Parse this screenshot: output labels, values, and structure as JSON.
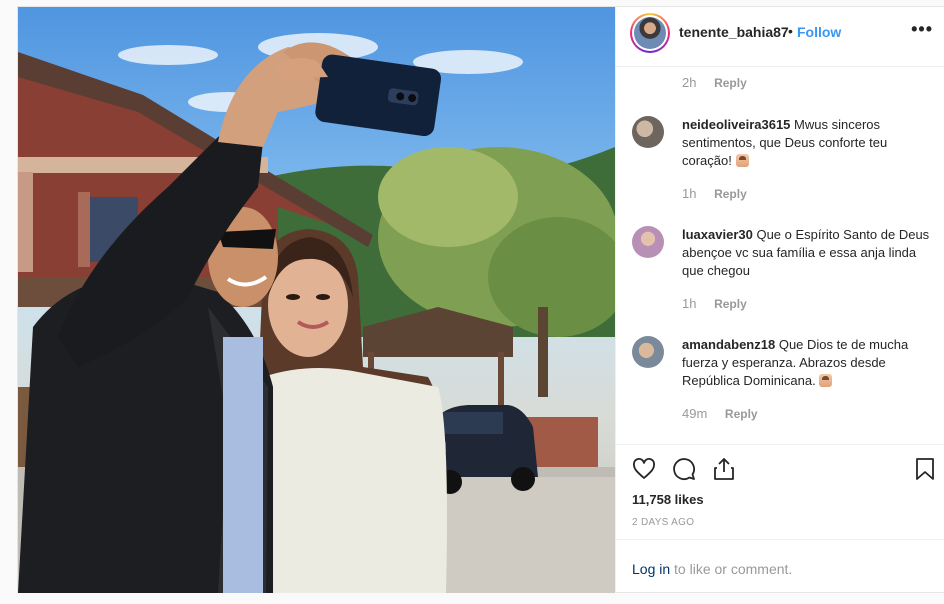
{
  "header": {
    "username": "tenente_bahia87",
    "separator": "•",
    "follow_label": "Follow",
    "more_label": "•••"
  },
  "comments": [
    {
      "username": "",
      "text": "",
      "time": "2h",
      "reply": "Reply"
    },
    {
      "username": "neideoliveira3615",
      "text": "Mwus sinceros sentimentos, que Deus conforte teu coração!",
      "time": "1h",
      "reply": "Reply"
    },
    {
      "username": "luaxavier30",
      "text": "Que o Espírito Santo de Deus abençoe vc sua família e essa anja linda que chegou",
      "time": "1h",
      "reply": "Reply"
    },
    {
      "username": "amandabenz18",
      "text": "Que Dios te de mucha fuerza y esperanza. Abrazos desde República Dominicana.",
      "time": "49m",
      "reply": "Reply"
    }
  ],
  "actions": {
    "like_icon": "heart-icon",
    "comment_icon": "comment-bubble-icon",
    "share_icon": "share-icon",
    "save_icon": "bookmark-icon"
  },
  "likes": "11,758 likes",
  "date": "2 DAYS AGO",
  "login": {
    "link": "Log in",
    "rest": " to like or comment."
  },
  "colors": {
    "accent": "#3897f0",
    "muted": "#999999",
    "link_dark": "#003569"
  }
}
